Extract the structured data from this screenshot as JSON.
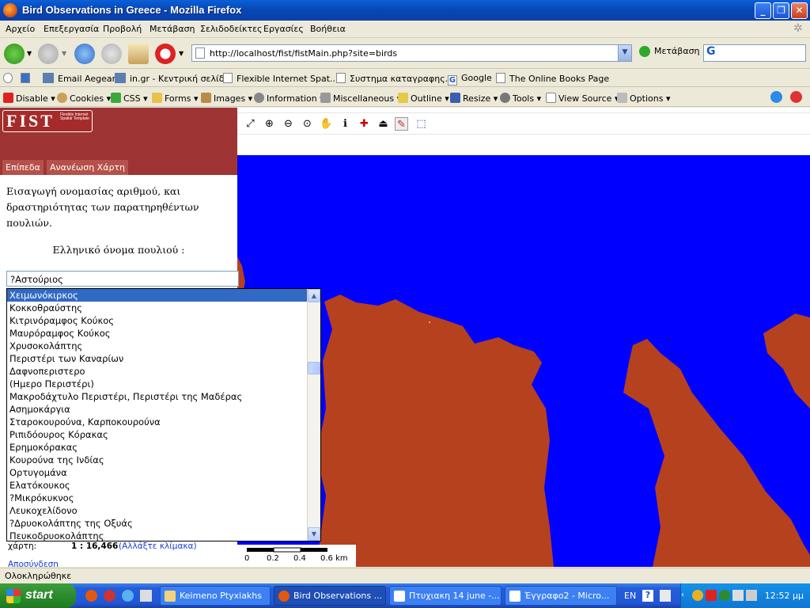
{
  "window": {
    "title": "Bird Observations in Greece - Mozilla Firefox",
    "buttons": {
      "minimize": "_",
      "maximize": "❐",
      "close": "✕"
    }
  },
  "menu": [
    "Αρχείο",
    "Επεξεργασία",
    "Προβολή",
    "Μετάβαση",
    "Σελιδοδείκτες",
    "Εργασίες",
    "Βοήθεια"
  ],
  "nav": {
    "url": "http://localhost/fist/fistMain.php?site=birds",
    "go_label": "Μετάβαση",
    "search_logo": "G"
  },
  "bookmarks": [
    "Email Aegean",
    "in.gr - Κεντρική σελίδα",
    "Flexible Internet Spat...",
    "Συστημα καταγραφης...",
    "Google",
    "The Online Books Page"
  ],
  "devbar": [
    "Disable",
    "Cookies",
    "CSS",
    "Forms",
    "Images",
    "Information",
    "Miscellaneous",
    "Outline",
    "Resize",
    "Tools",
    "View Source",
    "Options"
  ],
  "page": {
    "logo": "FIST",
    "logo_sub": "Flexible Internet Spatial Template",
    "tabs": [
      "Επίπεδα",
      "Ανανέωση Χάρτη"
    ],
    "intro": "Εισαγωγή ονομασίας αριθμού, και δραστηριότητας των παρατηρηθέντων πουλιών.",
    "name_label": "Ελληνικό όνομα πουλιού :",
    "selected": "?Αστούριος",
    "options": [
      "Χειμωνόκιρκος",
      "Κοκκοθραύστης",
      "Κιτρινόραμφος Κούκος",
      "Μαυρόραμφος Κούκος",
      "Χρυσοκολάπτης",
      "Περιστέρι των Καναρίων",
      "Δαφνοπεριστερο",
      "(Ημερο Περιστέρι)",
      "Μακροδάχτυλο Περιστέρι, Περιστέρι της Μαδέρας",
      "Ασημοκάργια",
      "Σταροκουρούνα, Καρποκουρούνα",
      "Ριπιδόουρος Κόρακας",
      "Ερημοκόρακας",
      "Κουρούνα της Ινδίας",
      "Ορτυγομάνα",
      "Ελατόκουκος",
      "?Μικρόκυκνος",
      "Λευκοχελίδονο",
      "?Δρυοκολάπτης της Οξυάς",
      "Πευκοδρυοκολάπτης"
    ],
    "scale_label": "χάρτη:",
    "scale_value": "1 : 16,466",
    "scale_link": "(Αλλάξτε κλίμακα)",
    "logout": "Αποσύνδεση",
    "scalebar_labels": [
      "0",
      "0.2",
      "0.4",
      "0.6 km"
    ]
  },
  "status": "Ολοκληρώθηκε",
  "taskbar": {
    "start": "start",
    "tasks": [
      "Keimeno Ptyxiakhs",
      "Bird Observations ...",
      "Πτυχιακη 14 june -...",
      "Έγγραφο2 - Micro..."
    ],
    "lang": "EN",
    "clock": "12:52 μμ"
  },
  "colors": {
    "land": "#b5411e",
    "sea": "#0000ff",
    "header": "#9e3434",
    "selection": "#316ac5"
  }
}
